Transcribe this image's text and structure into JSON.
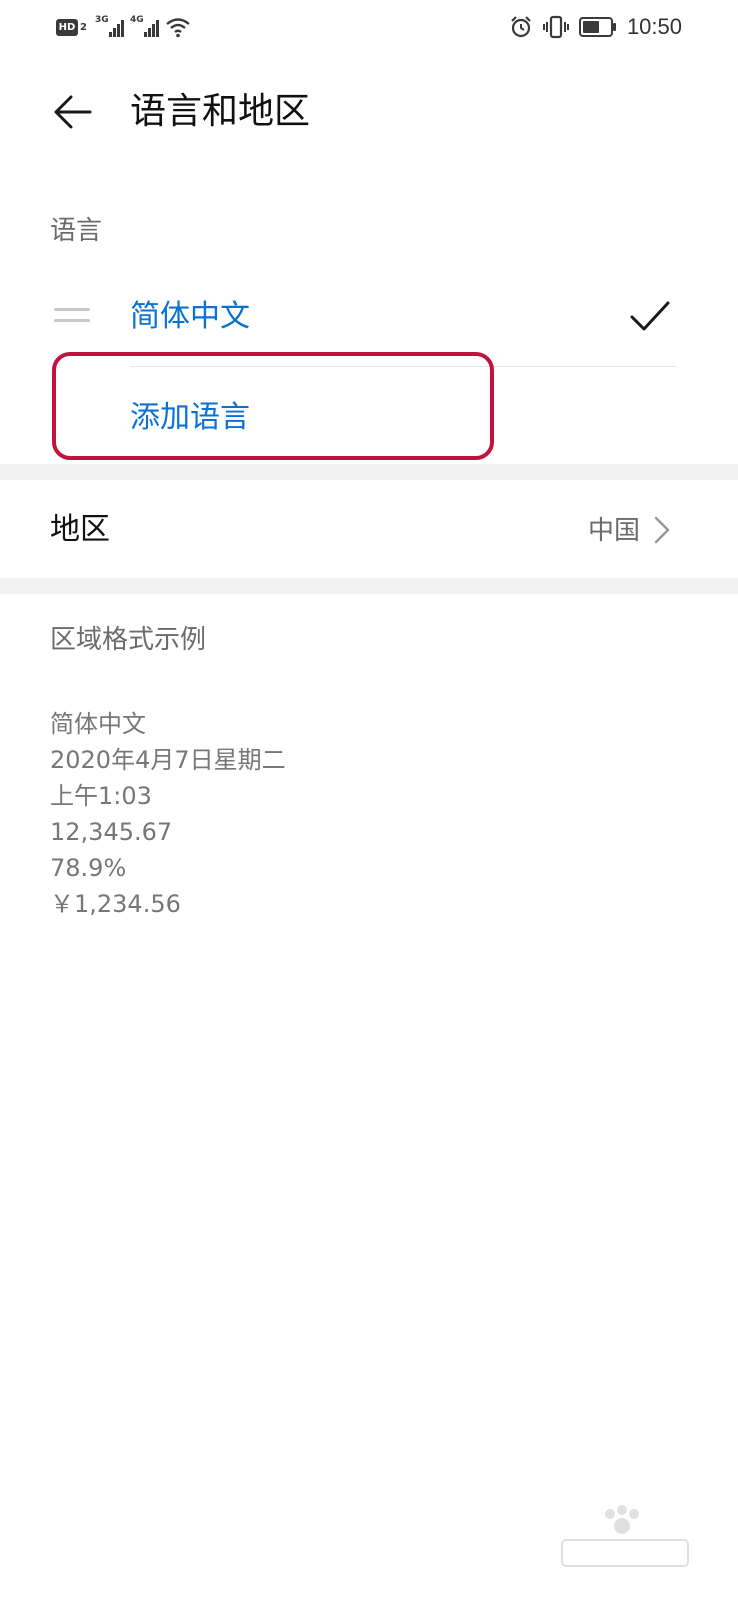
{
  "status_bar": {
    "hd_label": "HD",
    "hd_sub": "2",
    "sim1_tag": "3G",
    "sim2_tag": "4G",
    "time": "10:50",
    "icons": [
      "hd-voice-icon",
      "signal-icon",
      "signal-icon",
      "wifi-icon",
      "alarm-icon",
      "vibrate-icon",
      "battery-icon"
    ]
  },
  "header": {
    "title": "语言和地区",
    "back_icon": "back-arrow-icon"
  },
  "language": {
    "section_label": "语言",
    "items": [
      {
        "label": "简体中文",
        "selected": true
      }
    ],
    "add_label": "添加语言"
  },
  "region": {
    "label": "地区",
    "value": "中国"
  },
  "format_sample": {
    "label": "区域格式示例",
    "lines": [
      "简体中文",
      "2020年4月7日星期二",
      "上午1:03",
      "12,345.67",
      "78.9%",
      "￥1,234.56"
    ]
  },
  "colors": {
    "accent": "#0a72d6",
    "highlight_border": "#c2123e",
    "secondary_text": "#6b6b6b"
  }
}
